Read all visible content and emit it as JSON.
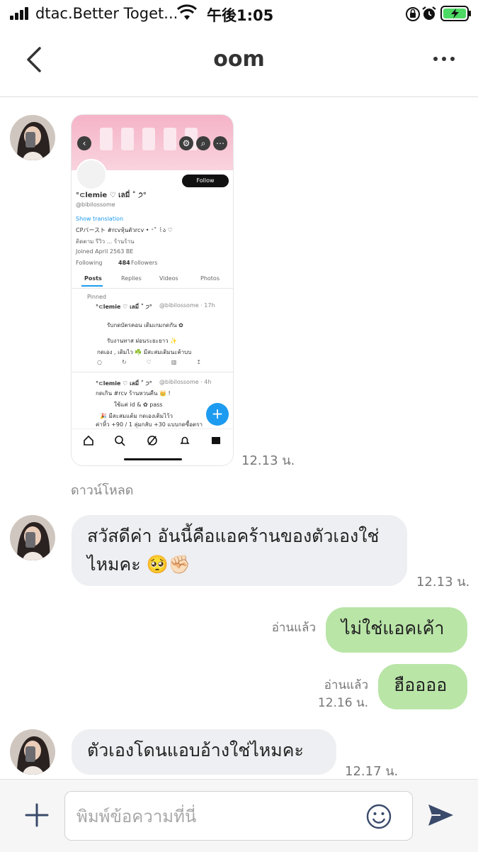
{
  "status_bar": {
    "carrier": "dtac.Better Toget...",
    "time": "午後1:05"
  },
  "header": {
    "title": "oom"
  },
  "messages": {
    "image": {
      "time": "12.13 น.",
      "download_label": "ดาวน์โหลด",
      "screenshot": {
        "name": "°⊂lemie ♡ เลมี่ ˚ ੭°",
        "handle": "@bibilossome",
        "show_translation": "Show translation",
        "bio_line1": "CPバースト #rcvหุ้นตัวrcv • ⁺˚ ꒰ა ♡",
        "bio_line2": "ติดตาม รีวิว ... ร้านร้าน",
        "joined": "Joined April 2563 BE",
        "following_label": "Following",
        "followers_count": "484",
        "followers_label": "Followers",
        "follow_button": "Follow",
        "tabs": [
          "Posts",
          "Replies",
          "Videos",
          "Photos"
        ],
        "pinned": "Pinned",
        "post1_name": "°⊂lemie ♡ เลมี่ ˚ ੭°",
        "post1_meta": "@bibilossome · 17h",
        "post1_line1": "รับกดบัตรคอน เติมเกมกดกัน ✿",
        "post1_line2": "รับงานทาส ฝอนระยะยาว ✨",
        "post1_line3": "กดเอง , เติมไว ☘️ มีสะสมเติมนะค้าบบ",
        "post2_name": "°⊂lemie ♡ เลมี่ ˚ ੭°",
        "post2_meta": "@bibilossome · 4h",
        "post2_line1": "กดเกิน #rcv ร้านหวนคืน 👑 !",
        "post2_line2": "ใช้แค่ id & ✿ pass",
        "post2_line3": "🎉 มีสะสมแต้ม กดเองเติมไว้ว",
        "post2_line4": "ค่าหิ้ว +90 / 1 ลุ่มกลับ +30 แบบกดซื้อตรา"
      }
    },
    "incoming1": {
      "text": "สวัสดีค่า อันนี้คือแอคร้านของตัวเองใช่ไหมคะ 🥺✊🏻",
      "time": "12.13 น."
    },
    "outgoing1": {
      "read_label": "อ่านแล้ว",
      "text": "ไม่ใช่แอคเค้า"
    },
    "outgoing2": {
      "read_label": "อ่านแล้ว",
      "time": "12.16 น.",
      "text": "ฮืออออ"
    },
    "incoming2": {
      "text": "ตัวเองโดนแอบอ้างใช่ไหมคะ",
      "time": "12.17 น."
    }
  },
  "input": {
    "placeholder": "พิมพ์ข้อความที่นี่"
  },
  "colors": {
    "incoming_bubble": "#eeeff2",
    "outgoing_bubble": "#b9e5a7",
    "battery": "#4cd964"
  }
}
